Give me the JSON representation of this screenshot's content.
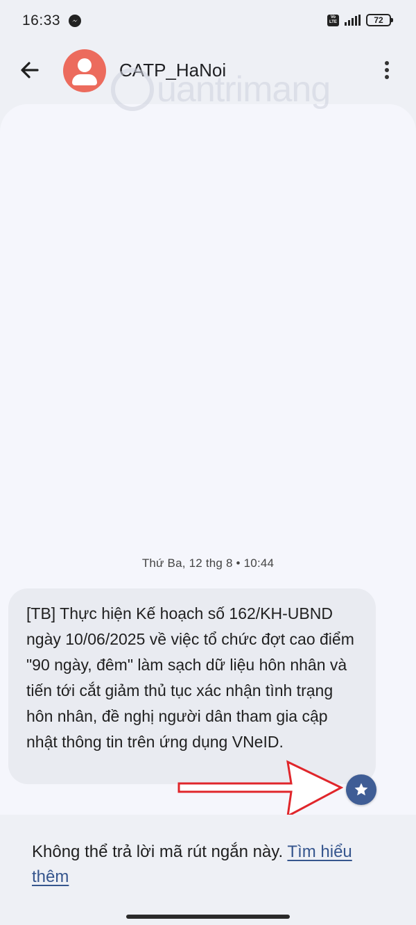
{
  "status_bar": {
    "time": "16:33",
    "network_badge_top": "Vo",
    "network_badge_bottom": "LTE",
    "battery": "72",
    "icons": [
      "messenger-icon",
      "volte-icon",
      "signal-icon",
      "battery-icon"
    ]
  },
  "app_bar": {
    "contact_name": "CATP_HaNoi",
    "icons": [
      "back-arrow-icon",
      "person-avatar-icon",
      "more-vert-icon"
    ]
  },
  "watermark": "uantrimang",
  "conversation": {
    "timestamp": "Thứ Ba, 12 thg 8 • 10:44",
    "messages": [
      {
        "text": "[TB] Thực hiện Kế hoạch số 162/KH-UBND ngày 10/06/2025 về việc tổ chức đợt cao điểm \"90 ngày, đêm\" làm sạch dữ liệu hôn nhân và tiến tới cắt giảm thủ tục xác nhận tình trạng hôn nhân, đề nghị người dân tham gia cập nhật thông tin trên ứng dụng VNeID."
      }
    ]
  },
  "reply_banner": {
    "text": "Không thể trả lời mã rút ngắn này. ",
    "link": "Tìm hiểu thêm"
  },
  "colors": {
    "avatar": "#ec6b5d",
    "star_button": "#3f5d95",
    "link": "#35558d",
    "annotation_arrow": "#e0262b"
  }
}
